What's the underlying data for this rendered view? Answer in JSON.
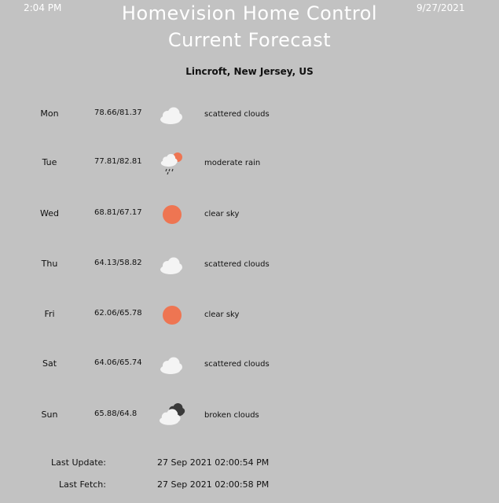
{
  "header": {
    "time": "2:04 PM",
    "date": "9/27/2021",
    "title_line1": "Homevision Home Control",
    "title_line2": "Current Forecast",
    "location": "Lincroft, New Jersey, US"
  },
  "forecast": [
    {
      "day": "Mon",
      "temps": "78.66/81.37",
      "icon": "scattered-clouds-icon",
      "desc": "scattered clouds"
    },
    {
      "day": "Tue",
      "temps": "77.81/82.81",
      "icon": "rain-sun-icon",
      "desc": "moderate rain"
    },
    {
      "day": "Wed",
      "temps": "68.81/67.17",
      "icon": "sun-icon",
      "desc": "clear sky"
    },
    {
      "day": "Thu",
      "temps": "64.13/58.82",
      "icon": "scattered-clouds-icon",
      "desc": "scattered clouds"
    },
    {
      "day": "Fri",
      "temps": "62.06/65.78",
      "icon": "sun-icon",
      "desc": "clear sky"
    },
    {
      "day": "Sat",
      "temps": "64.06/65.74",
      "icon": "scattered-clouds-icon",
      "desc": "scattered clouds"
    },
    {
      "day": "Sun",
      "temps": "65.88/64.8",
      "icon": "broken-clouds-icon",
      "desc": "broken clouds"
    }
  ],
  "footer": {
    "last_update_label": "Last Update:",
    "last_update_value": "27 Sep 2021 02:00:54 PM",
    "last_fetch_label": "Last Fetch:",
    "last_fetch_value": "27 Sep 2021 02:00:58 PM"
  },
  "colors": {
    "background": "#c2c2c2",
    "sun": "#ee7552",
    "cloud": "#f4f4f4",
    "dark_cloud": "#3a3a3a"
  }
}
